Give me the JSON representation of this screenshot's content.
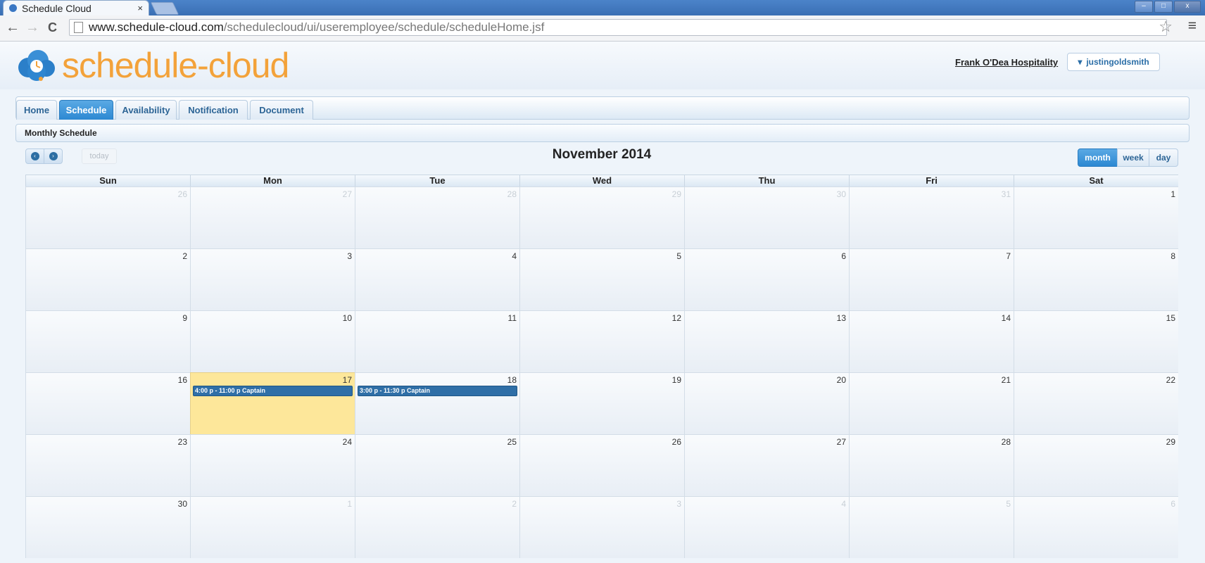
{
  "browser": {
    "tab_title": "Schedule Cloud",
    "tab_close": "×",
    "url_host": "www.schedule-cloud.com",
    "url_path": "/schedulecloud/ui/useremployee/schedule/scheduleHome.jsf",
    "back": "←",
    "forward": "→",
    "reload": "C",
    "star": "☆",
    "menu": "≡",
    "win_min": "–",
    "win_max": "□",
    "win_close": "x"
  },
  "header": {
    "logo_text": "schedule-cloud",
    "company": "Frank O'Dea Hospitality",
    "user": "justingoldsmith",
    "user_caret": "▾"
  },
  "nav": {
    "tabs": [
      {
        "label": "Home",
        "active": false
      },
      {
        "label": "Schedule",
        "active": true
      },
      {
        "label": "Availability",
        "active": false
      },
      {
        "label": "Notification",
        "active": false
      },
      {
        "label": "Document",
        "active": false
      }
    ]
  },
  "section": {
    "title": "Monthly Schedule"
  },
  "calendar": {
    "title": "November 2014",
    "prev_icon": "‹",
    "next_icon": "›",
    "today_label": "today",
    "views": [
      {
        "label": "month",
        "active": true
      },
      {
        "label": "week",
        "active": false
      },
      {
        "label": "day",
        "active": false
      }
    ],
    "days_of_week": [
      "Sun",
      "Mon",
      "Tue",
      "Wed",
      "Thu",
      "Fri",
      "Sat"
    ],
    "weeks": [
      [
        {
          "day": "26",
          "other": true
        },
        {
          "day": "27",
          "other": true
        },
        {
          "day": "28",
          "other": true
        },
        {
          "day": "29",
          "other": true
        },
        {
          "day": "30",
          "other": true
        },
        {
          "day": "31",
          "other": true
        },
        {
          "day": "1",
          "other": false
        }
      ],
      [
        {
          "day": "2",
          "other": false
        },
        {
          "day": "3",
          "other": false
        },
        {
          "day": "4",
          "other": false
        },
        {
          "day": "5",
          "other": false
        },
        {
          "day": "6",
          "other": false
        },
        {
          "day": "7",
          "other": false
        },
        {
          "day": "8",
          "other": false
        }
      ],
      [
        {
          "day": "9",
          "other": false
        },
        {
          "day": "10",
          "other": false
        },
        {
          "day": "11",
          "other": false
        },
        {
          "day": "12",
          "other": false
        },
        {
          "day": "13",
          "other": false
        },
        {
          "day": "14",
          "other": false
        },
        {
          "day": "15",
          "other": false
        }
      ],
      [
        {
          "day": "16",
          "other": false
        },
        {
          "day": "17",
          "other": false,
          "today": true,
          "event": "4:00 p - 11:00 p Captain"
        },
        {
          "day": "18",
          "other": false,
          "event": "3:00 p - 11:30 p Captain"
        },
        {
          "day": "19",
          "other": false
        },
        {
          "day": "20",
          "other": false
        },
        {
          "day": "21",
          "other": false
        },
        {
          "day": "22",
          "other": false
        }
      ],
      [
        {
          "day": "23",
          "other": false
        },
        {
          "day": "24",
          "other": false
        },
        {
          "day": "25",
          "other": false
        },
        {
          "day": "26",
          "other": false
        },
        {
          "day": "27",
          "other": false
        },
        {
          "day": "28",
          "other": false
        },
        {
          "day": "29",
          "other": false
        }
      ],
      [
        {
          "day": "30",
          "other": false
        },
        {
          "day": "1",
          "other": true
        },
        {
          "day": "2",
          "other": true
        },
        {
          "day": "3",
          "other": true
        },
        {
          "day": "4",
          "other": true
        },
        {
          "day": "5",
          "other": true
        },
        {
          "day": "6",
          "other": true
        }
      ]
    ]
  },
  "colors": {
    "accent": "#2c88d2",
    "event_bg": "#2f6fa7",
    "today_bg": "#fde79a",
    "logo_orange": "#f3a23a"
  }
}
